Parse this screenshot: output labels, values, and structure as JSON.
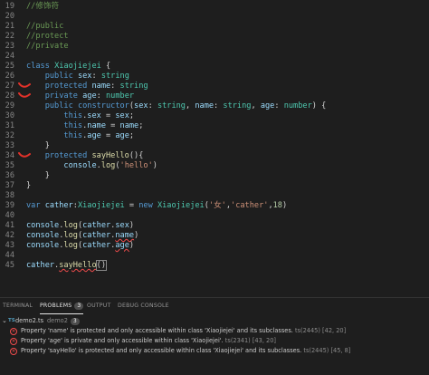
{
  "editor": {
    "lines": [
      {
        "n": "19",
        "html": "<span class=\"cm\">//修饰符</span>"
      },
      {
        "n": "20",
        "html": ""
      },
      {
        "n": "21",
        "html": "<span class=\"cm\">//public</span>"
      },
      {
        "n": "22",
        "html": "<span class=\"cm\">//protect</span>"
      },
      {
        "n": "23",
        "html": "<span class=\"cm\">//private</span>"
      },
      {
        "n": "24",
        "html": ""
      },
      {
        "n": "25",
        "html": "<span class=\"kw\">class</span> <span class=\"ty\">Xiaojiejei</span> {"
      },
      {
        "n": "26",
        "html": "    <span class=\"kw\">public</span> <span class=\"var\">sex</span>: <span class=\"ty\">string</span>"
      },
      {
        "n": "27",
        "html": "    <span class=\"kw\">protected</span> <span class=\"var\">name</span>: <span class=\"ty\">string</span>"
      },
      {
        "n": "28",
        "html": "    <span class=\"kw\">private</span> <span class=\"var\">age</span>: <span class=\"ty\">number</span>"
      },
      {
        "n": "29",
        "html": "    <span class=\"kw\">public</span> <span class=\"kw\">constructor</span>(<span class=\"var\">sex</span>: <span class=\"ty\">string</span>, <span class=\"var\">name</span>: <span class=\"ty\">string</span>, <span class=\"var\">age</span>: <span class=\"ty\">number</span>) {"
      },
      {
        "n": "30",
        "html": "        <span class=\"this\">this</span>.<span class=\"var\">sex</span> = <span class=\"var\">sex</span>;"
      },
      {
        "n": "31",
        "html": "        <span class=\"this\">this</span>.<span class=\"var\">name</span> = <span class=\"var\">name</span>;"
      },
      {
        "n": "32",
        "html": "        <span class=\"this\">this</span>.<span class=\"var\">age</span> = <span class=\"var\">age</span>;"
      },
      {
        "n": "33",
        "html": "    }"
      },
      {
        "n": "34",
        "html": "    <span class=\"kw\">protected</span> <span class=\"fn\">sayHello</span>(){"
      },
      {
        "n": "35",
        "html": "        <span class=\"var\">console</span>.<span class=\"fn\">log</span>(<span class=\"str\">'hello'</span>)"
      },
      {
        "n": "36",
        "html": "    }"
      },
      {
        "n": "37",
        "html": "}"
      },
      {
        "n": "38",
        "html": ""
      },
      {
        "n": "39",
        "html": "<span class=\"kw\">var</span> <span class=\"var\">cather</span>:<span class=\"ty\">Xiaojiejei</span> = <span class=\"kw\">new</span> <span class=\"ty\">Xiaojiejei</span>(<span class=\"str\">'女'</span>,<span class=\"str\">'cather'</span>,<span class=\"num\">18</span>)"
      },
      {
        "n": "40",
        "html": ""
      },
      {
        "n": "41",
        "html": "<span class=\"var\">console</span>.<span class=\"fn\">log</span>(<span class=\"var\">cather</span>.<span class=\"var\">sex</span>)"
      },
      {
        "n": "42",
        "html": "<span class=\"var\">console</span>.<span class=\"fn\">log</span>(<span class=\"var\">cather</span>.<span class=\"var err\">name</span>)"
      },
      {
        "n": "43",
        "html": "<span class=\"var\">console</span>.<span class=\"fn\">log</span>(<span class=\"var\">cather</span>.<span class=\"var err\">age</span>)"
      },
      {
        "n": "44",
        "html": ""
      },
      {
        "n": "45",
        "html": "<span class=\"var\">cather</span>.<span class=\"fn err\">sayHello</span><span class=\"bracket-box\">()</span>"
      }
    ]
  },
  "panel": {
    "tabs": [
      {
        "label": "TERMINAL"
      },
      {
        "label": "PROBLEMS",
        "count": "3"
      },
      {
        "label": "OUTPUT"
      },
      {
        "label": "DEBUG CONSOLE"
      }
    ],
    "file": {
      "icon": "TS",
      "name": "demo2.ts",
      "dir": "demo2",
      "count": "3"
    },
    "errors": [
      {
        "message": "Property 'name' is protected and only accessible within class 'Xiaojiejei' and its subclasses.",
        "source": "ts(2445)",
        "position": "[42, 20]"
      },
      {
        "message": "Property 'age' is private and only accessible within class 'Xiaojiejei'.",
        "source": "ts(2341)",
        "position": "[43, 20]"
      },
      {
        "message": "Property 'sayHello' is protected and only accessible within class 'Xiaojiejei' and its subclasses.",
        "source": "ts(2445)",
        "position": "[45, 8]"
      }
    ]
  }
}
